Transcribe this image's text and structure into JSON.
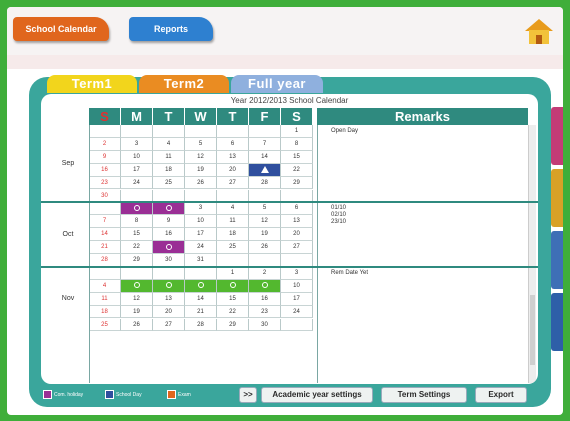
{
  "topbar": {
    "calendar_button": "School Calendar",
    "other_button": "Reports"
  },
  "tabs": [
    "Term1",
    "Term2",
    "Full year"
  ],
  "calendar_title": "Year 2012/2013 School Calendar",
  "day_headers": [
    "S",
    "M",
    "T",
    "W",
    "T",
    "F",
    "S"
  ],
  "remarks_header": "Remarks",
  "months": [
    {
      "label": "Sep",
      "weeks": [
        [
          "",
          "",
          "",
          "",
          "",
          "",
          "1"
        ],
        [
          "2",
          "3",
          "4",
          "5",
          "6",
          "7",
          "8"
        ],
        [
          "9",
          "10",
          "11",
          "12",
          "13",
          "14",
          "15"
        ],
        [
          "16",
          "17",
          "18",
          "19",
          "20",
          "21",
          "22"
        ],
        [
          "23",
          "24",
          "25",
          "26",
          "27",
          "28",
          "29"
        ],
        [
          "30",
          "",
          "",
          "",
          "",
          "",
          ""
        ]
      ],
      "remarks": [
        "Open Day"
      ]
    },
    {
      "label": "Oct",
      "weeks": [
        [
          "",
          "1",
          "2",
          "3",
          "4",
          "5",
          "6"
        ],
        [
          "7",
          "8",
          "9",
          "10",
          "11",
          "12",
          "13"
        ],
        [
          "14",
          "15",
          "16",
          "17",
          "18",
          "19",
          "20"
        ],
        [
          "21",
          "22",
          "23",
          "24",
          "25",
          "26",
          "27"
        ],
        [
          "28",
          "29",
          "30",
          "31",
          "",
          "",
          ""
        ]
      ],
      "remarks": [
        "01/10",
        "02/10",
        "23/10"
      ]
    },
    {
      "label": "Nov",
      "weeks": [
        [
          "",
          "",
          "",
          "",
          "1",
          "2",
          "3"
        ],
        [
          "4",
          "5",
          "6",
          "7",
          "8",
          "9",
          "10"
        ],
        [
          "11",
          "12",
          "13",
          "14",
          "15",
          "16",
          "17"
        ],
        [
          "18",
          "19",
          "20",
          "21",
          "22",
          "23",
          "24"
        ],
        [
          "25",
          "26",
          "27",
          "28",
          "29",
          "30",
          ""
        ]
      ],
      "remarks": [
        "Rem Date Yet"
      ]
    }
  ],
  "legend": [
    {
      "label": "Com. holiday",
      "color": "#9a2f95"
    },
    {
      "label": "School Day",
      "color": "#2f4f9e"
    },
    {
      "label": "Exam",
      "color": "#e0661d"
    }
  ],
  "footer": {
    "next_label": ">>",
    "academic_settings": "Academic year settings",
    "term_settings": "Term Settings",
    "export": "Export"
  },
  "colors": {
    "accent_green": "#3fae3a",
    "panel_teal": "#3aa69c",
    "header_teal": "#2f8a7f",
    "holiday_purple": "#9a2f95",
    "event_green": "#53b82f",
    "school_day_blue": "#2f4f9e"
  }
}
